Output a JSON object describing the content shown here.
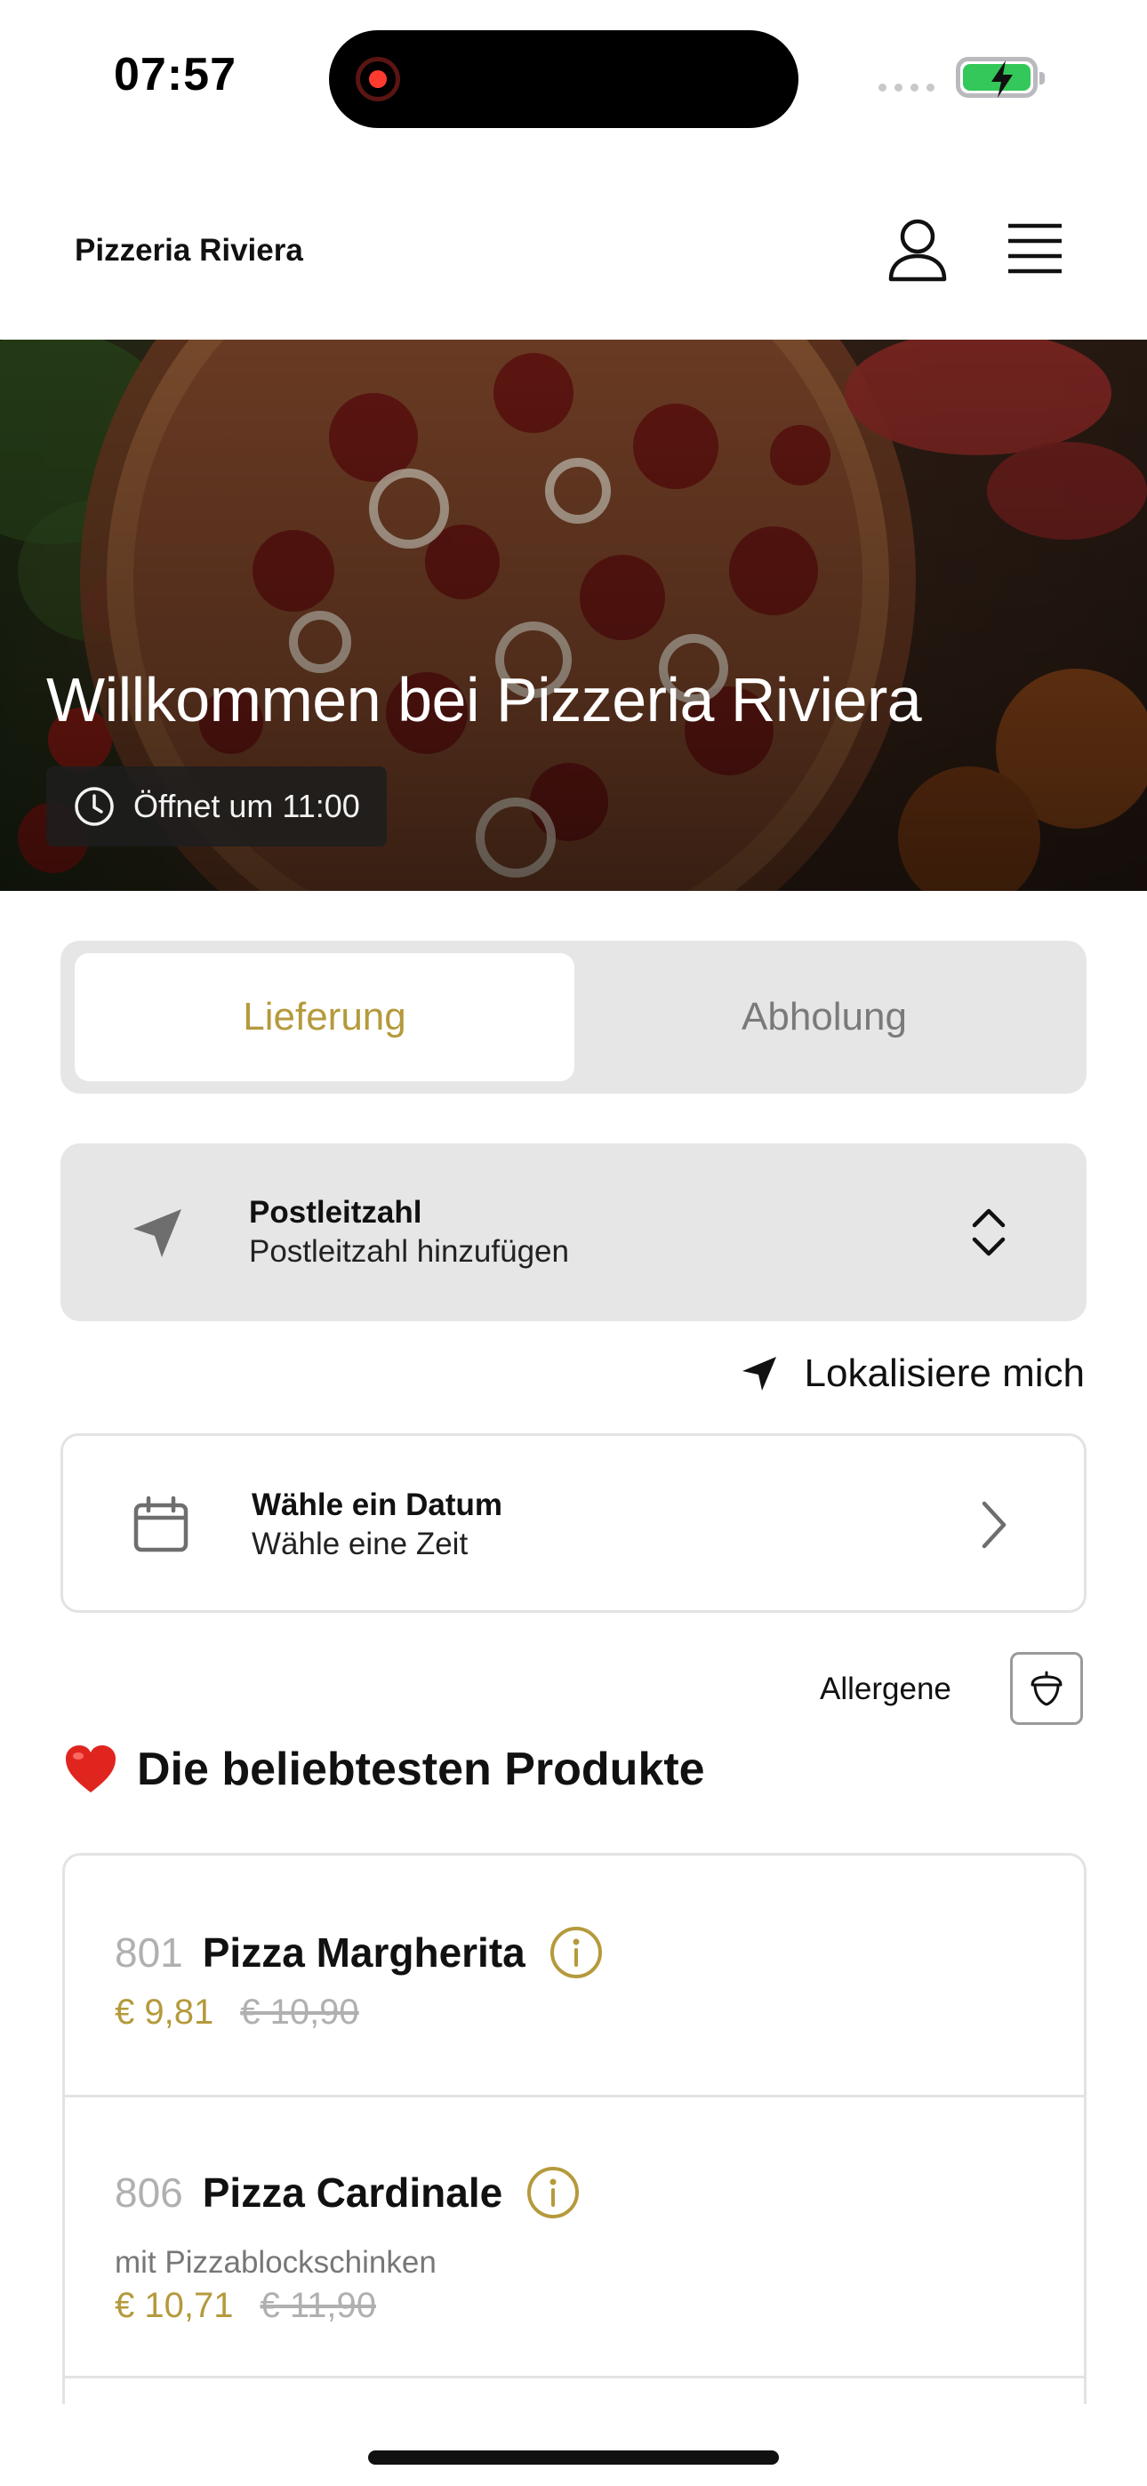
{
  "status_bar": {
    "time": "07:57"
  },
  "header": {
    "brand": "Pizzeria Riviera",
    "profile_icon": "person-icon",
    "menu_icon": "hamburger-menu-icon"
  },
  "hero": {
    "title": "Willkommen bei Pizzeria Riviera",
    "badge": "Öffnet um 11:00",
    "badge_icon": "clock-icon"
  },
  "order_type": {
    "options": [
      "Lieferung",
      "Abholung"
    ],
    "selected": "Lieferung"
  },
  "postal_code": {
    "title": "Postleitzahl",
    "placeholder": "Postleitzahl hinzufügen",
    "icon": "location-arrow-icon"
  },
  "locate": {
    "label": "Lokalisiere mich"
  },
  "date_picker": {
    "title": "Wähle ein Datum",
    "subtitle": "Wähle eine Zeit"
  },
  "allergens": {
    "label": "Allergene",
    "icon": "acorn-icon"
  },
  "popular": {
    "title": "Die beliebtesten Produkte",
    "icon": "heart-icon",
    "products": [
      {
        "number": "801",
        "name": "Pizza Margherita",
        "description": "",
        "price": "€ 9,81",
        "old_price": "€ 10,90"
      },
      {
        "number": "806",
        "name": "Pizza Cardinale",
        "description": "mit Pizzablockschinken",
        "price": "€ 10,71",
        "old_price": "€ 11,90"
      }
    ]
  },
  "colors": {
    "accent": "#b59a3c",
    "panel": "#e6e6e6",
    "muted": "#b0b0b0"
  }
}
